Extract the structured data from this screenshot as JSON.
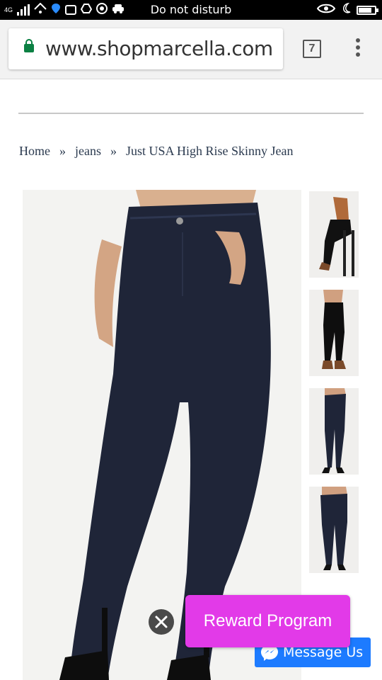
{
  "status_bar": {
    "network": "4G",
    "center_text": "Do not disturb",
    "icons": [
      "signal-icon",
      "wifi-icon",
      "location-icon",
      "photo-icon",
      "drive-icon",
      "chrome-icon",
      "car-icon",
      "eye-icon",
      "moon-icon",
      "battery-icon"
    ]
  },
  "browser": {
    "url": "www.shopmarcella.com",
    "tab_count": "7",
    "secure_color": "#0b8043"
  },
  "breadcrumb": {
    "items": [
      "Home",
      "jeans",
      "Just USA High Rise Skinny Jean"
    ],
    "separator": "»"
  },
  "product": {
    "main_image": "high-rise-skinny-jean-front-photo",
    "thumbnails": [
      "jean-seated-stool-photo",
      "jean-side-view-photo",
      "jean-front-full-photo",
      "jean-back-full-photo"
    ]
  },
  "overlays": {
    "reward_label": "Reward Program",
    "reward_color": "#e23ae8",
    "message_label": "Message Us",
    "message_color": "#1d7bff"
  }
}
